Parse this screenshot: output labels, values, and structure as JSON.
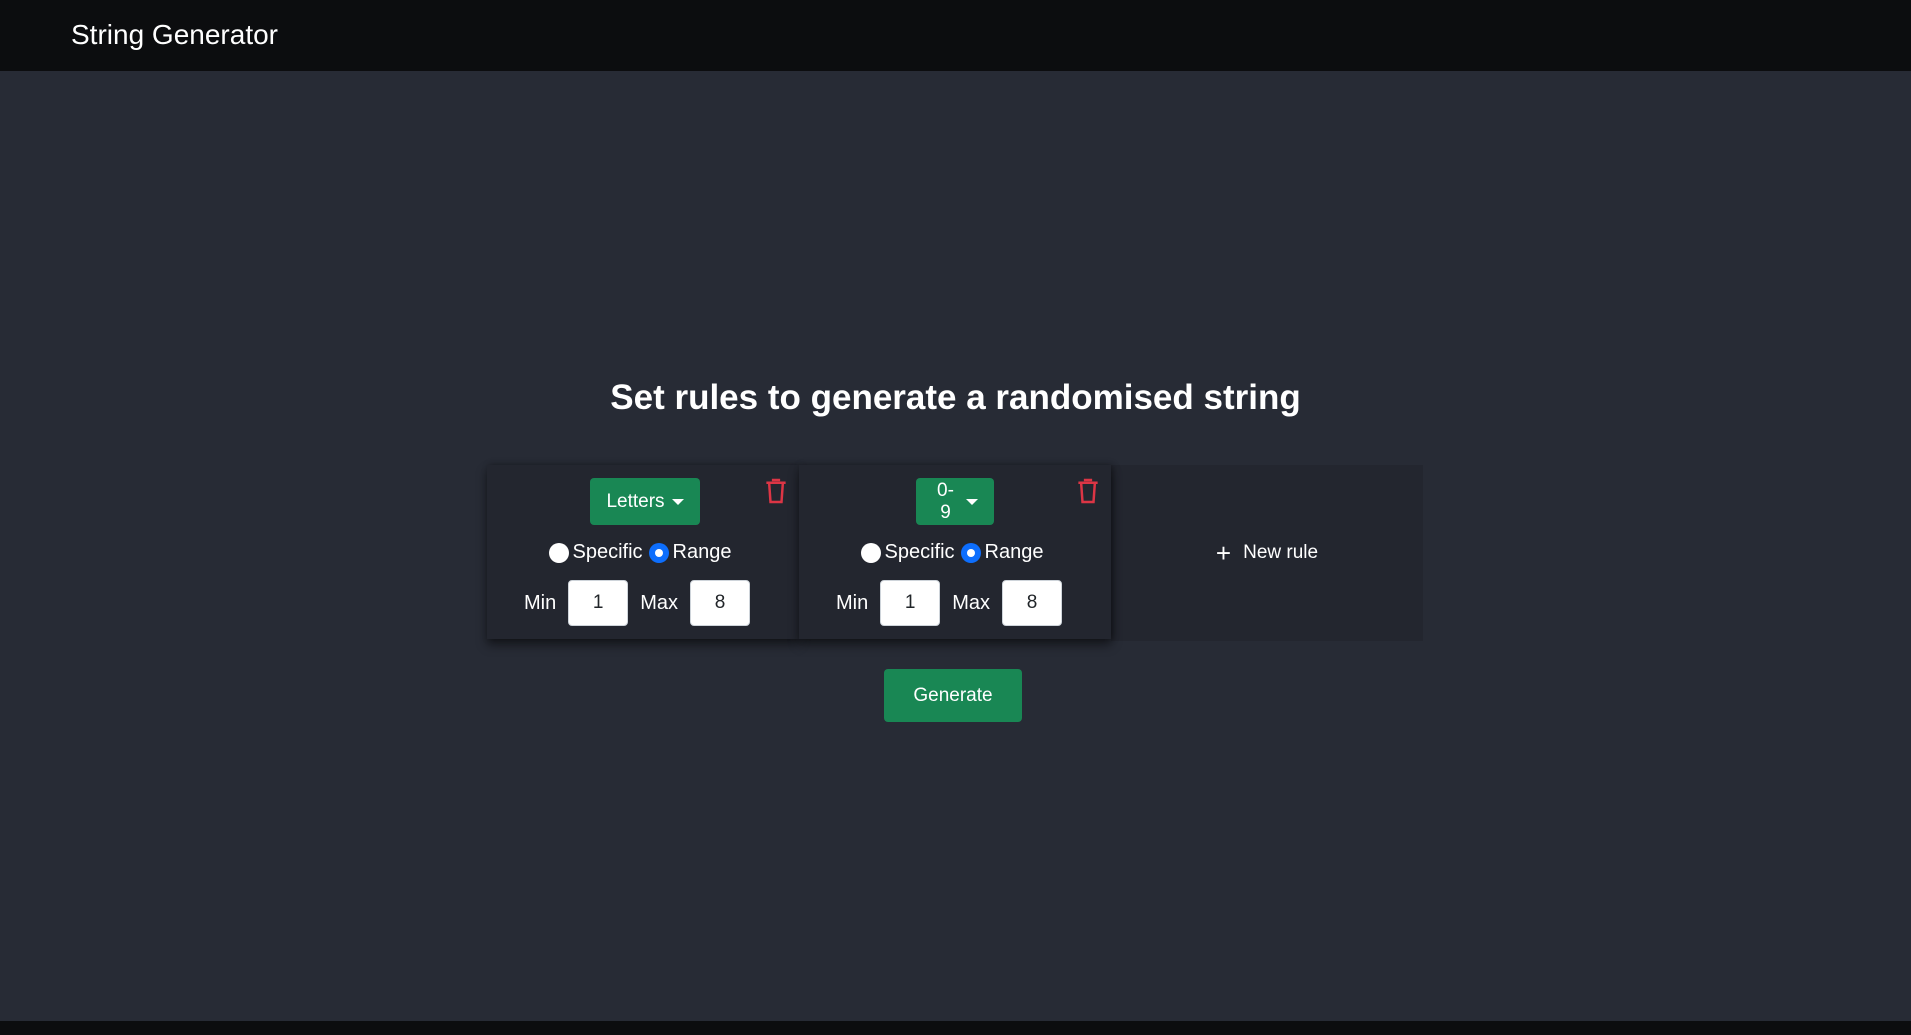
{
  "navbar": {
    "brand": "String Generator"
  },
  "main": {
    "heading": "Set rules to generate a randomised string",
    "rules": [
      {
        "type_label": "Letters",
        "mode_options": [
          "Specific",
          "Range"
        ],
        "selected_mode": "Range",
        "min_label": "Min",
        "min_value": "1",
        "max_label": "Max",
        "max_value": "8"
      },
      {
        "type_label": "0-9",
        "mode_options": [
          "Specific",
          "Range"
        ],
        "selected_mode": "Range",
        "min_label": "Min",
        "min_value": "1",
        "max_label": "Max",
        "max_value": "8"
      }
    ],
    "new_rule_label": "New rule",
    "generate_label": "Generate"
  },
  "icons": {
    "delete": "trash-icon",
    "add": "plus-icon",
    "dropdown": "chevron-down-icon"
  },
  "colors": {
    "accent": "#198754",
    "danger": "#dc3545",
    "radio_checked": "#0d6efd",
    "background": "#272b35",
    "navbar": "#0c0d0f"
  }
}
